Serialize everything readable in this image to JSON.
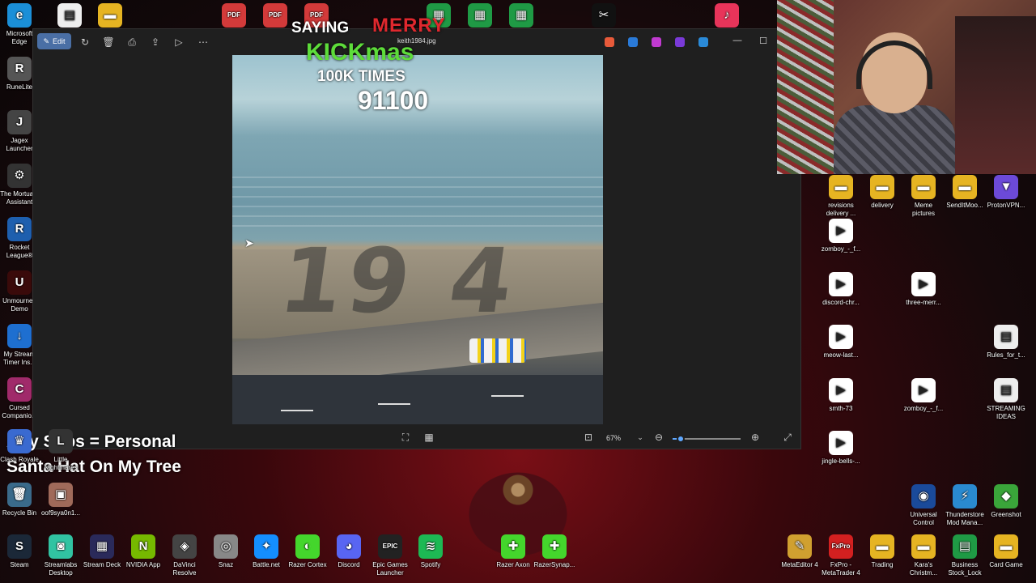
{
  "left_icons": [
    {
      "label": "Microsoft Edge",
      "glyph": "e",
      "color": "#1b8fd8"
    },
    {
      "label": "RuneLite",
      "glyph": "R",
      "color": "#555555"
    },
    {
      "label": "Jagex Launcher",
      "glyph": "J",
      "color": "#444444"
    },
    {
      "label": "The Mortuary Assistant",
      "glyph": "⚙",
      "color": "#333333"
    },
    {
      "label": "Rocket League®",
      "glyph": "R",
      "color": "#1e5fae"
    },
    {
      "label": "Unmourned Demo",
      "glyph": "U",
      "color": "#3a0a0a"
    },
    {
      "label": "My Stream Timer Ins...",
      "glyph": "↓",
      "color": "#1e6fd0"
    },
    {
      "label": "Cursed Companio...",
      "glyph": "C",
      "color": "#a02a6a"
    }
  ],
  "top_icons": [
    {
      "glyph": "▤",
      "color": "#eeeeee"
    },
    {
      "glyph": "▬",
      "color": "#e6b422"
    },
    {
      "glyph": "PDF",
      "color": "#d33a3a"
    },
    {
      "glyph": "PDF",
      "color": "#d33a3a"
    },
    {
      "glyph": "PDF",
      "color": "#d33a3a"
    },
    {
      "glyph": "▦",
      "color": "#1f9a45"
    },
    {
      "glyph": "▦",
      "color": "#1f9a45"
    },
    {
      "glyph": "▦",
      "color": "#1f9a45"
    },
    {
      "glyph": "✂",
      "color": "#111111"
    },
    {
      "glyph": "♪",
      "color": "#e8345a"
    }
  ],
  "photos_app": {
    "edit_label": "Edit",
    "file_name": "keith1984.jpg",
    "zoom_level": "67%",
    "zoom_fraction": 0.12,
    "photo_sand_text": "19 4"
  },
  "overlay": {
    "saying": "SAYING",
    "merry": "MERRY",
    "kickmas": "KICKmas",
    "times": "100K TIMES",
    "counter": "91100",
    "subs_line1": "Any Subs = Personal",
    "subs_line2": "Santa Hat On My Tree"
  },
  "right_icons": [
    {
      "label": "revisions delivery ...",
      "glyph": "▬",
      "color": "#e6b422"
    },
    {
      "label": "delivery",
      "glyph": "▬",
      "color": "#e6b422"
    },
    {
      "label": "Meme pictures",
      "glyph": "▬",
      "color": "#e6b422"
    },
    {
      "label": "SendItMoo...",
      "glyph": "▬",
      "color": "#e6b422"
    },
    {
      "label": "ProtonVPN...",
      "glyph": "▼",
      "color": "#6c4ad8"
    },
    {
      "label": "zomboy_-_f...",
      "glyph": "▶",
      "color": "#ffffff"
    },
    {
      "label": "discord-chr...",
      "glyph": "▶",
      "color": "#ffffff"
    },
    {
      "label": "three-merr...",
      "glyph": "▶",
      "color": "#ffffff"
    },
    {
      "label": "meow-last...",
      "glyph": "▶",
      "color": "#ffffff"
    },
    {
      "label": "Rules_for_t...",
      "glyph": "▤",
      "color": "#eeeeee"
    },
    {
      "label": "smth-73",
      "glyph": "▶",
      "color": "#ffffff"
    },
    {
      "label": "zomboy_-_f...",
      "glyph": "▶",
      "color": "#ffffff"
    },
    {
      "label": "STREAMING IDEAS",
      "glyph": "▤",
      "color": "#eeeeee"
    },
    {
      "label": "jingle-bells-...",
      "glyph": "▶",
      "color": "#ffffff"
    },
    {
      "label": "Universal Control",
      "glyph": "◉",
      "color": "#1a4a9a"
    },
    {
      "label": "Thunderstore Mod Mana...",
      "glyph": "⚡",
      "color": "#2a8ad0"
    },
    {
      "label": "Greenshot",
      "glyph": "◆",
      "color": "#3aa53a"
    }
  ],
  "bottom_left_icons": [
    {
      "label": "Clash Royale",
      "glyph": "♛",
      "color": "#3a6ad0"
    },
    {
      "label": "Little Nightmares",
      "glyph": "L",
      "color": "#333333"
    },
    {
      "label": "Recycle Bin",
      "glyph": "🗑",
      "color": "#3a6a8a"
    },
    {
      "label": "oof9sya0n1...",
      "glyph": "▣",
      "color": "#a06a5a"
    }
  ],
  "bottom_row": [
    {
      "label": "Steam",
      "glyph": "S",
      "color": "#1b2838"
    },
    {
      "label": "Streamlabs Desktop",
      "glyph": "◙",
      "color": "#31c3a2"
    },
    {
      "label": "Stream Deck",
      "glyph": "▦",
      "color": "#2a2a5a"
    },
    {
      "label": "NVIDIA App",
      "glyph": "N",
      "color": "#76b900"
    },
    {
      "label": "DaVinci Resolve",
      "glyph": "◈",
      "color": "#444444"
    },
    {
      "label": "Snaz",
      "glyph": "◎",
      "color": "#888888"
    },
    {
      "label": "Battle.net",
      "glyph": "✦",
      "color": "#148eff"
    },
    {
      "label": "Razer Cortex",
      "glyph": "◐",
      "color": "#44d62c"
    },
    {
      "label": "Discord",
      "glyph": "◕",
      "color": "#5865f2"
    },
    {
      "label": "Epic Games Launcher",
      "glyph": "EPIC",
      "color": "#222222"
    },
    {
      "label": "Spotify",
      "glyph": "≋",
      "color": "#1db954"
    },
    {
      "label": "Razer Axon",
      "glyph": "✚",
      "color": "#44d62c"
    },
    {
      "label": "RazerSynap...",
      "glyph": "✚",
      "color": "#44d62c"
    }
  ],
  "bottom_right_icons": [
    {
      "label": "MetaEditor 4",
      "glyph": "✎",
      "color": "#d0a030"
    },
    {
      "label": "FxPro - MetaTrader 4",
      "glyph": "FxPro",
      "color": "#d32020"
    },
    {
      "label": "Trading",
      "glyph": "▬",
      "color": "#e6b422"
    },
    {
      "label": "Kara's Christm...",
      "glyph": "▬",
      "color": "#e6b422"
    },
    {
      "label": "Business Stock_Lock",
      "glyph": "▤",
      "color": "#1f9a45"
    },
    {
      "label": "Card Game",
      "glyph": "▬",
      "color": "#e6b422"
    }
  ]
}
